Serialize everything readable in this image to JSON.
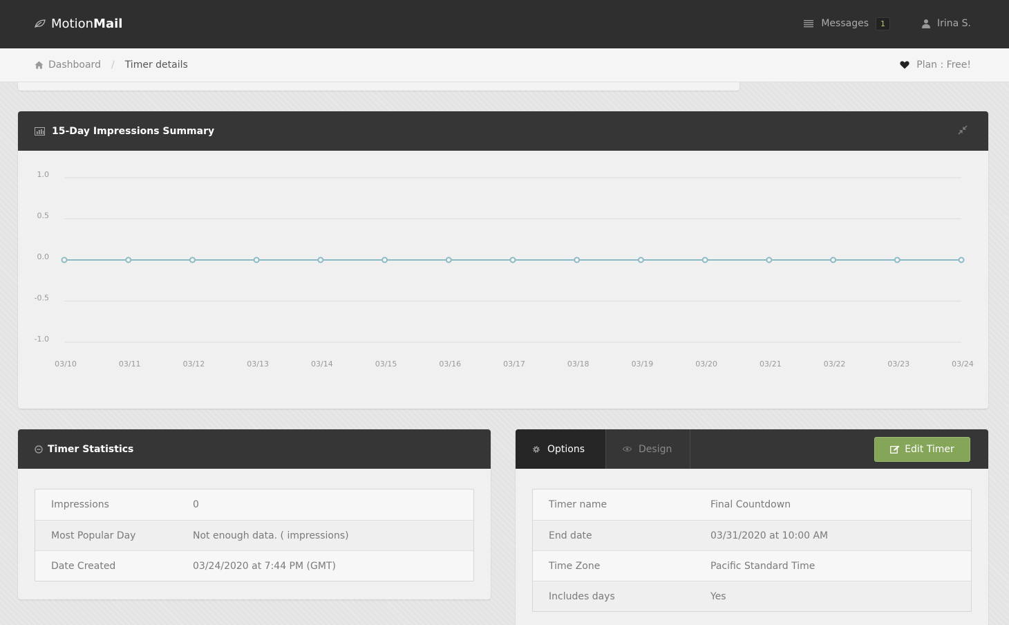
{
  "header": {
    "brand_light": "Motion",
    "brand_bold": "Mail",
    "messages_label": "Messages",
    "messages_count": "1",
    "user_name": "Irina S."
  },
  "breadcrumb": {
    "home": "Dashboard",
    "separator": "/",
    "current": "Timer details",
    "plan": "Plan : Free!"
  },
  "impressions_panel": {
    "title": "15-Day Impressions Summary"
  },
  "chart_data": {
    "type": "line",
    "x": [
      "03/10",
      "03/11",
      "03/12",
      "03/13",
      "03/14",
      "03/15",
      "03/16",
      "03/17",
      "03/18",
      "03/19",
      "03/20",
      "03/21",
      "03/22",
      "03/23",
      "03/24"
    ],
    "series": [
      {
        "values": [
          0,
          0,
          0,
          0,
          0,
          0,
          0,
          0,
          0,
          0,
          0,
          0,
          0,
          0,
          0
        ]
      }
    ],
    "y_ticks": [
      "1.0",
      "0.5",
      "0.0",
      "-0.5",
      "-1.0"
    ],
    "ylim": [
      -1,
      1
    ],
    "grid": true,
    "line_color": "#8bbcc6"
  },
  "stats_panel": {
    "title": "Timer Statistics",
    "rows": [
      {
        "label": "Impressions",
        "value": "0"
      },
      {
        "label": "Most Popular Day",
        "value": "Not enough data. ( impressions)"
      },
      {
        "label": "Date Created",
        "value": "03/24/2020 at 7:44 PM (GMT)"
      }
    ]
  },
  "options_panel": {
    "tabs": [
      {
        "label": "Options",
        "active": true
      },
      {
        "label": "Design",
        "active": false
      }
    ],
    "edit_button": "Edit Timer",
    "rows": [
      {
        "label": "Timer name",
        "value": "Final Countdown"
      },
      {
        "label": "End date",
        "value": "03/31/2020 at 10:00 AM"
      },
      {
        "label": "Time Zone",
        "value": "Pacific Standard Time"
      },
      {
        "label": "Includes days",
        "value": "Yes"
      }
    ]
  },
  "colors": {
    "topbar": "#2f2f2f",
    "panel_header": "#363636",
    "edit_button": "#85a659",
    "badge_text": "#b5d36b"
  }
}
